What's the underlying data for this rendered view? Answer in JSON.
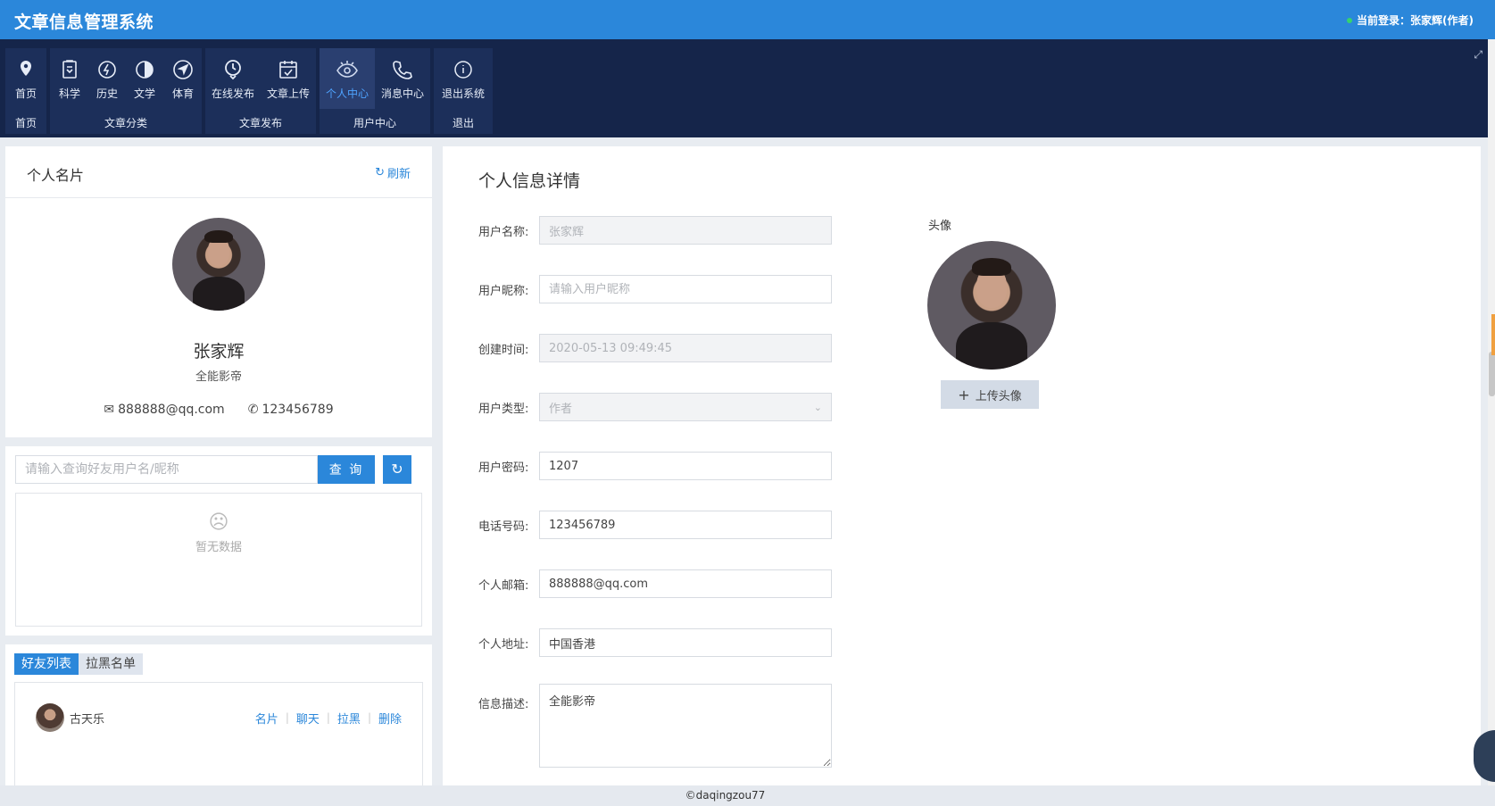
{
  "header": {
    "app_title": "文章信息管理系统",
    "login_info": "当前登录：张家辉(作者)"
  },
  "ribbon": {
    "groups": [
      {
        "label": "首页",
        "buttons": [
          {
            "label": "首页",
            "icon": "location-pin-icon"
          }
        ]
      },
      {
        "label": "文章分类",
        "buttons": [
          {
            "label": "科学",
            "icon": "clipboard-icon"
          },
          {
            "label": "历史",
            "icon": "bolt-icon"
          },
          {
            "label": "文学",
            "icon": "pie-icon"
          },
          {
            "label": "体育",
            "icon": "navigation-icon"
          }
        ]
      },
      {
        "label": "文章发布",
        "buttons": [
          {
            "label": "在线发布",
            "icon": "clock-pin-icon"
          },
          {
            "label": "文章上传",
            "icon": "calendar-check-icon"
          }
        ]
      },
      {
        "label": "用户中心",
        "buttons": [
          {
            "label": "个人中心",
            "icon": "eye-icon",
            "active": true
          },
          {
            "label": "消息中心",
            "icon": "phone-icon"
          }
        ]
      },
      {
        "label": "退出",
        "buttons": [
          {
            "label": "退出系统",
            "icon": "info-icon"
          }
        ]
      }
    ]
  },
  "profile_card": {
    "title": "个人名片",
    "refresh_label": "刷新",
    "name": "张家辉",
    "motto": "全能影帝",
    "email": "888888@qq.com",
    "phone": "123456789"
  },
  "friend_search": {
    "placeholder": "请输入查询好友用户名/昵称",
    "search_label": "查 询",
    "empty_text": "暂无数据"
  },
  "friends": {
    "tabs": [
      "好友列表",
      "拉黑名单"
    ],
    "list": [
      {
        "name": "古天乐",
        "actions": [
          "名片",
          "聊天",
          "拉黑",
          "删除"
        ]
      }
    ]
  },
  "detail": {
    "title": "个人信息详情",
    "fields": {
      "username": {
        "label": "用户名称:",
        "value": "张家辉"
      },
      "nickname": {
        "label": "用户昵称:",
        "placeholder": "请输入用户昵称"
      },
      "created": {
        "label": "创建时间:",
        "value": "2020-05-13 09:49:45"
      },
      "usertype": {
        "label": "用户类型:",
        "value": "作者"
      },
      "password": {
        "label": "用户密码:",
        "value": "1207"
      },
      "phone": {
        "label": "电话号码:",
        "value": "123456789"
      },
      "email": {
        "label": "个人邮箱:",
        "value": "888888@qq.com"
      },
      "address": {
        "label": "个人地址:",
        "value": "中国香港"
      },
      "description": {
        "label": "信息描述:",
        "value": "全能影帝"
      }
    },
    "avatar_label": "头像",
    "upload_label": "上传头像"
  },
  "footer": {
    "text": "©daqingzou77"
  },
  "colors": {
    "primary": "#2b87da",
    "ribbon_bg": "#15254a"
  }
}
